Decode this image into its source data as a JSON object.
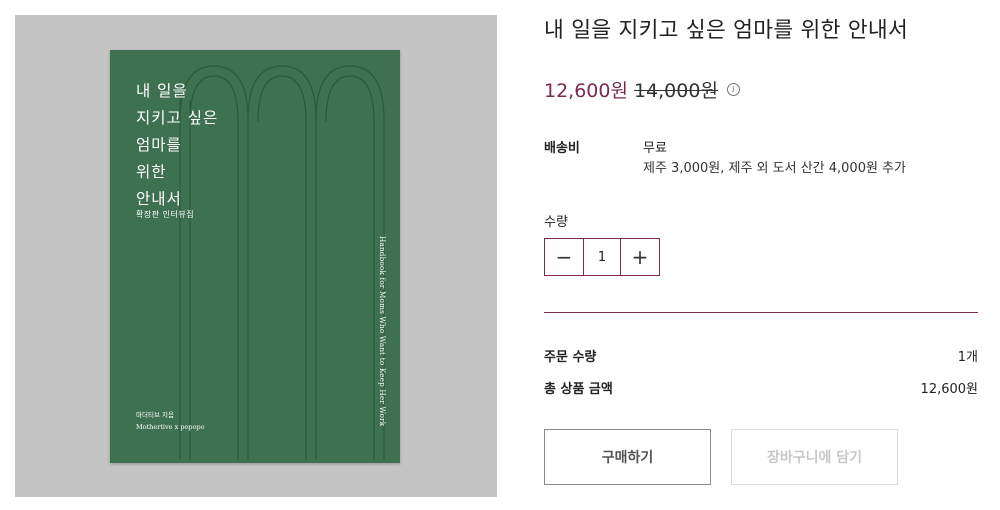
{
  "cover": {
    "title_lines": [
      "내 일을",
      "지키고 싶은",
      "엄마를",
      "위한",
      "안내서"
    ],
    "subtitle": "확장판 인터뷰집",
    "english_title": "Handbook for Moms Who Want to Keep Her Work",
    "author_lines": [
      "마더티브 지음",
      "Mothertive x popopo"
    ],
    "background_color": "#3d7150"
  },
  "product": {
    "title": "내 일을 지키고 싶은 엄마를 위한 안내서",
    "sale_price": "12,600원",
    "original_price": "14,000원",
    "info_icon": "info-icon"
  },
  "shipping": {
    "label": "배송비",
    "value": "무료",
    "note": "제주 3,000원, 제주 외 도서 산간 4,000원 추가"
  },
  "quantity": {
    "label": "수량",
    "minus": "−",
    "value": "1",
    "plus": "+"
  },
  "summary": {
    "order_qty_label": "주문 수량",
    "order_qty_value": "1개",
    "total_label": "총 상품 금액",
    "total_value": "12,600원"
  },
  "actions": {
    "buy_label": "구매하기",
    "cart_label": "장바구니에 담기"
  },
  "colors": {
    "accent": "#7b2a52",
    "cover_green": "#3d7150",
    "image_bg": "#c4c4c4"
  }
}
